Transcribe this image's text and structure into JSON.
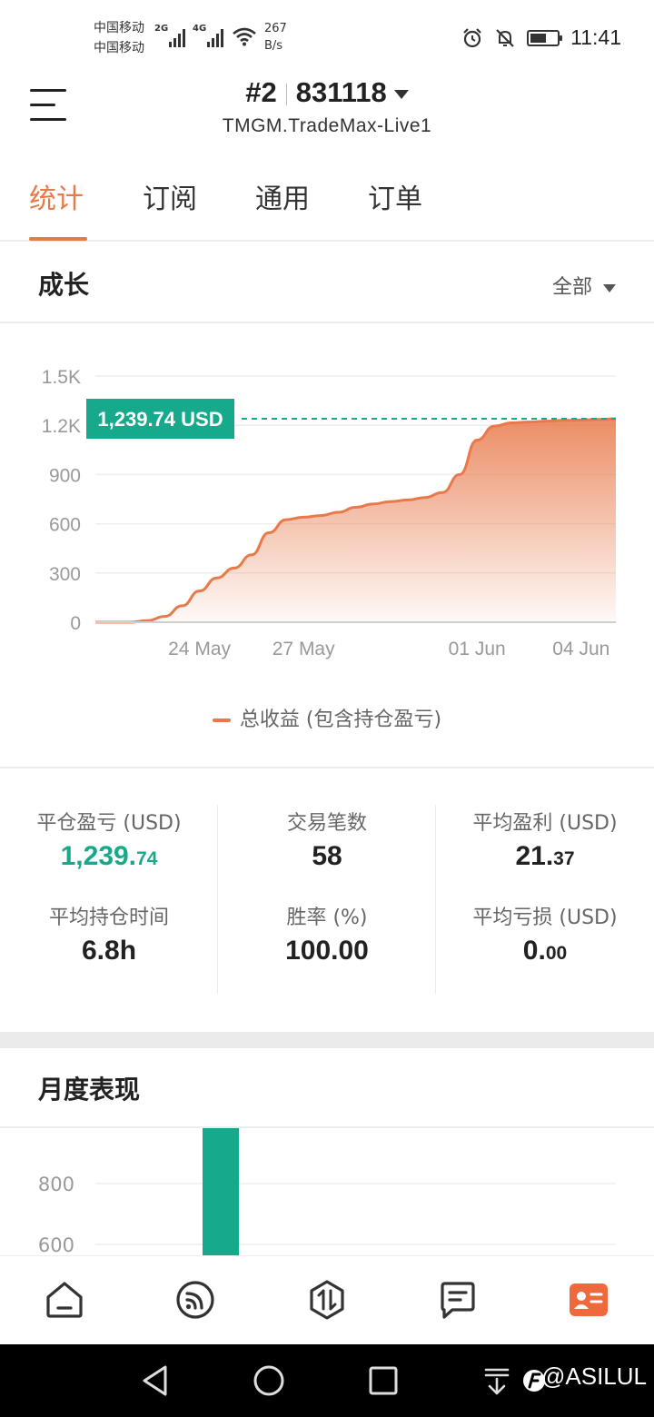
{
  "status_bar": {
    "carrier_1": "中国移动",
    "carrier_2": "中国移动",
    "net_1": "2G",
    "net_2": "4G",
    "speed_value": "267",
    "speed_unit": "B/s",
    "time": "11:41",
    "battery_level": 0.6
  },
  "header": {
    "account_index": "#2",
    "account_number": "831118",
    "server": "TMGM.TradeMax-Live1"
  },
  "tabs": [
    {
      "label": "统计",
      "active": true
    },
    {
      "label": "订阅",
      "active": false
    },
    {
      "label": "通用",
      "active": false
    },
    {
      "label": "订单",
      "active": false
    }
  ],
  "growth": {
    "title": "成长",
    "filter": "全部",
    "legend": "总收益 (包含持仓盈亏)",
    "current_value_label": "1,239.74 USD"
  },
  "chart_data": [
    {
      "type": "area",
      "ylim": [
        0,
        1500
      ],
      "yticks": [
        "0",
        "300",
        "600",
        "900",
        "1.2K",
        "1.5K"
      ],
      "ytick_values": [
        0,
        300,
        600,
        900,
        1200,
        1500
      ],
      "xticks": [
        "24 May",
        "27 May",
        "01 Jun",
        "04 Jun"
      ],
      "xtick_values": [
        24,
        27,
        32,
        35
      ],
      "xlim": [
        21,
        36
      ],
      "grid": true,
      "legend_position": "bottom",
      "series": [
        {
          "name": "总收益 (包含持仓盈亏)",
          "color": "#e8794a",
          "x": [
            21,
            22,
            22.5,
            23,
            23.5,
            24,
            24.5,
            25,
            25.5,
            26,
            26.5,
            27,
            27.5,
            28,
            28.5,
            29,
            29.5,
            30,
            30.5,
            31,
            31.5,
            32,
            32.5,
            33,
            33.5,
            34,
            34.5,
            35,
            35.5,
            36
          ],
          "y": [
            0,
            0,
            10,
            35,
            100,
            190,
            270,
            330,
            410,
            545,
            625,
            640,
            650,
            670,
            700,
            720,
            735,
            745,
            760,
            790,
            900,
            1110,
            1195,
            1215,
            1220,
            1225,
            1230,
            1232,
            1236,
            1239.74
          ]
        }
      ],
      "reference_line": {
        "value": 1239.74,
        "label": "1,239.74 USD",
        "color": "#17a98c"
      }
    },
    {
      "type": "bar",
      "title": "月度表现",
      "ylim_visible": [
        550,
        850
      ],
      "yticks": [
        "800",
        "600"
      ],
      "ytick_values": [
        800,
        600
      ],
      "series": [
        {
          "color": "#17a98c",
          "values": [
            1239.74
          ]
        }
      ]
    }
  ],
  "stats": {
    "closed_pnl": {
      "label": "平仓盈亏 (USD)",
      "int": "1,239.",
      "dec": "74"
    },
    "trade_count": {
      "label": "交易笔数",
      "value": "58"
    },
    "avg_profit": {
      "label": "平均盈利 (USD)",
      "int": "21.",
      "dec": "37"
    },
    "avg_hold": {
      "label": "平均持仓时间",
      "value": "6.8h"
    },
    "win_rate": {
      "label": "胜率 (%)",
      "value": "100.00"
    },
    "avg_loss": {
      "label": "平均亏损 (USD)",
      "int": "0.",
      "dec": "00"
    }
  },
  "monthly": {
    "title": "月度表现"
  },
  "bottom_nav": [
    {
      "icon": "home-icon",
      "active": false
    },
    {
      "icon": "signal-feed-icon",
      "active": false
    },
    {
      "icon": "trade-icon",
      "active": false
    },
    {
      "icon": "message-icon",
      "active": false
    },
    {
      "icon": "profile-card-icon",
      "active": true
    }
  ],
  "colors": {
    "accent": "#e8794a",
    "green": "#17a98c",
    "text": "#222222",
    "muted": "#666666"
  },
  "watermark": "@ASILUL"
}
